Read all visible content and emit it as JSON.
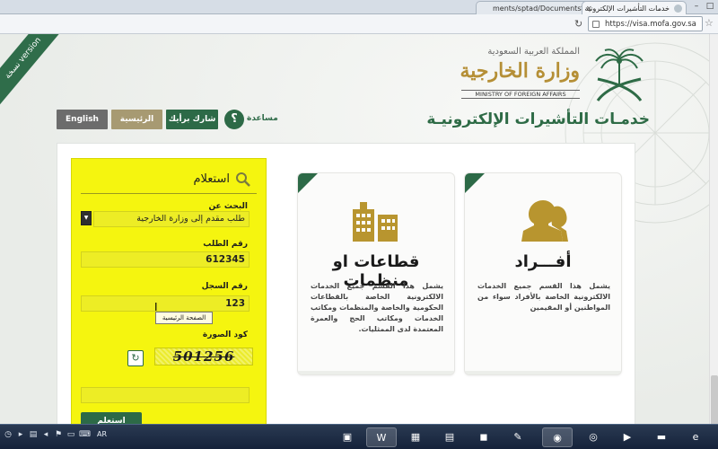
{
  "browser": {
    "active_tab_title": "خدمات التأشيرات الإلكترونية",
    "second_tab_title": "ments/sptad/Documents",
    "address": "https://visa.mofa.gov.sa"
  },
  "header": {
    "ribbon_text": "نسخة\nversion",
    "kingdom": "المملكة العربية السعودية",
    "ministry_ar": "وزارة الخارجية",
    "ministry_en": "MINISTRY OF FOREIGN AFFAIRS",
    "services_title": "خدمـات التأشيرات الإلكترونيـة"
  },
  "nav": {
    "english": "English",
    "home": "الرئيسية",
    "share": "شارك برأيك",
    "help_symbol": "؟",
    "help": "مساعدة"
  },
  "inquiry": {
    "title": "استعلام",
    "search_by_label": "البحث عن",
    "search_by_value": "طلب مقدم إلى وزارة الخارجية",
    "request_no_label": "رقم الطلب",
    "request_no_value": "612345",
    "record_no_label": "رقم السجل",
    "record_no_value": "123",
    "tooltip": "الصفحة الرئيسية",
    "captcha_label": "كود الصورة",
    "captcha_value": "501256",
    "submit": "استعلم"
  },
  "cards": {
    "individuals": {
      "title": "أفـــراد",
      "desc": "يشمل هذا القسم جميع الخدمات الالكترونية الخاصة بالأفراد سواء من المواطنين أو المقيمين"
    },
    "organizations": {
      "title": "قطاعات او منظمات",
      "desc": "يشمل هذا القسم جميع الخدمات الالكترونية الخاصة بالقطاعات الحكومية والخاصة والمنظمات ومكاتب الخدمات ومكاتب الحج والعمرة المعتمدة لدى الممثليات."
    }
  },
  "taskbar": {
    "lang": "AR"
  },
  "colors": {
    "brand_green": "#2d6a47",
    "gold": "#b58f36",
    "highlight": "#f5f50f"
  }
}
